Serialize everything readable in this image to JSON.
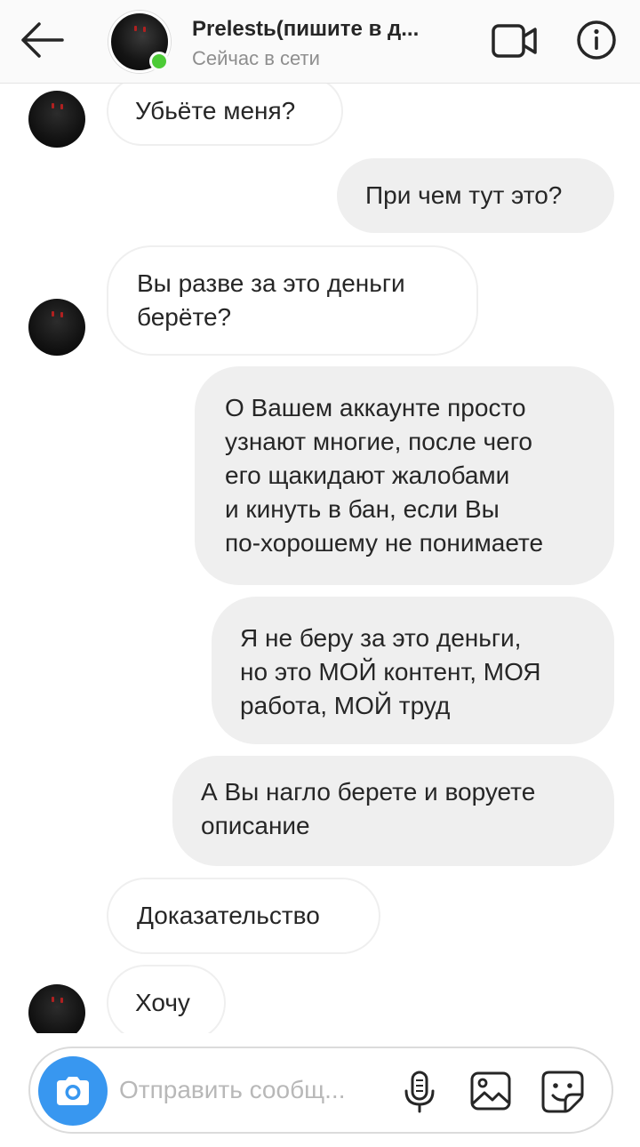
{
  "header": {
    "title": "Prelestь(пишите в д...",
    "status": "Сейчас в сети",
    "back_icon": "arrow-left-icon",
    "video_icon": "video-camera-icon",
    "info_icon": "info-icon"
  },
  "messages": [
    {
      "text": "Убьёте меня?",
      "direction": "in"
    },
    {
      "text": "При чем тут это?",
      "direction": "out"
    },
    {
      "text": "Вы разве за это деньги\nберёте?",
      "direction": "in"
    },
    {
      "text": "О Вашем аккаунте просто\nузнают многие, после чего\nего щакидают жалобами\nи кинуть в бан, если Вы\nпо-хорошему не понимаете",
      "direction": "out"
    },
    {
      "text": "Я не беру за это деньги,\nно это МОЙ контент, МОЯ\nработа, МОЙ труд",
      "direction": "out"
    },
    {
      "text": "А Вы нагло берете и воруете\nописание",
      "direction": "out"
    },
    {
      "text": "Доказательство",
      "direction": "in"
    },
    {
      "text": "Хочу",
      "direction": "in"
    }
  ],
  "composer": {
    "placeholder": "Отправить сообщ...",
    "camera_icon": "camera-icon",
    "mic_icon": "microphone-icon",
    "gallery_icon": "gallery-icon",
    "sticker_icon": "sticker-icon"
  },
  "colors": {
    "accent": "#3897f0",
    "online": "#4ccb36",
    "outgoing_bubble": "#efefef",
    "incoming_border": "#efefef",
    "secondary_text": "#8e8e8e"
  }
}
